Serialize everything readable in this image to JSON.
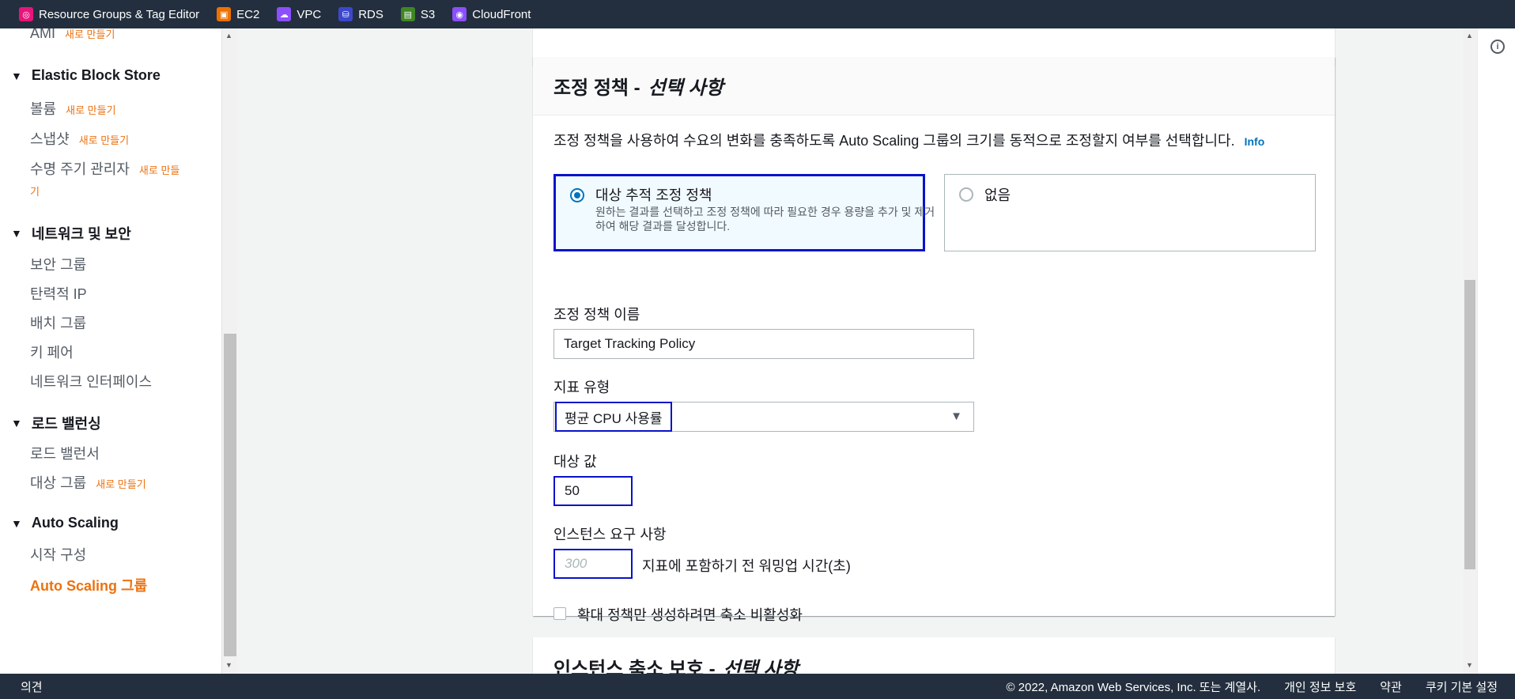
{
  "favorites": [
    {
      "label": "Resource Groups & Tag Editor",
      "color": "#e7157b",
      "icon": "resource-groups-icon"
    },
    {
      "label": "EC2",
      "color": "#ed7100",
      "icon": "ec2-icon"
    },
    {
      "label": "VPC",
      "color": "#8c4fff",
      "icon": "vpc-icon"
    },
    {
      "label": "RDS",
      "color": "#3b48cc",
      "icon": "rds-icon"
    },
    {
      "label": "S3",
      "color": "#3f8624",
      "icon": "s3-icon"
    },
    {
      "label": "CloudFront",
      "color": "#8c4fff",
      "icon": "cloudfront-icon"
    }
  ],
  "sidebar": {
    "ami": "AMI",
    "new": "새로 만들기",
    "ebs": "Elastic Block Store",
    "volumes": "볼륨",
    "snapshots": "스냅샷",
    "lifecycle": "수명 주기 관리자",
    "lifecycle_new_1": "새로 만들",
    "lifecycle_new_2": "기",
    "network": "네트워크 및 보안",
    "security_groups": "보안 그룹",
    "elastic_ip": "탄력적 IP",
    "placement_groups": "배치 그룹",
    "key_pairs": "키 페어",
    "network_interfaces": "네트워크 인터페이스",
    "load_balancing": "로드 밸런싱",
    "load_balancers": "로드 밸런서",
    "target_groups": "대상 그룹",
    "auto_scaling": "Auto Scaling",
    "launch_configs": "시작 구성",
    "asg": "Auto Scaling 그룹"
  },
  "card": {
    "title": "조정 정책 -",
    "optional": "선택 사항",
    "description": "조정 정책을 사용하여 수요의 변화를 충족하도록 Auto Scaling 그룹의 크기를 동적으로 조정할지 여부를 선택합니다.",
    "info": "Info",
    "option_target": "대상 추적 조정 정책",
    "option_target_desc": "원하는 결과를 선택하고 조정 정책에 따라 필요한 경우 용량을 추가 및 제거하여 해당 결과를 달성합니다.",
    "option_none": "없음",
    "policy_name_label": "조정 정책 이름",
    "policy_name_value": "Target Tracking Policy",
    "metric_label": "지표 유형",
    "metric_value": "평균 CPU 사용률",
    "target_label": "대상 값",
    "target_value": "50",
    "warmup_label": "인스턴스 요구 사항",
    "warmup_placeholder": "300",
    "warmup_text": "지표에 포함하기 전 워밍업 시간(초)",
    "disable_scale_in": "확대 정책만 생성하려면 축소 비활성화"
  },
  "next_card": {
    "title": "인스턴스 축소 보호 -",
    "optional": "선택 사항"
  },
  "footer": {
    "feedback": "의견",
    "copyright": "© 2022, Amazon Web Services, Inc. 또는 계열사.",
    "privacy": "개인 정보 보호",
    "terms": "약관",
    "cookies": "쿠키 기본 설정"
  }
}
